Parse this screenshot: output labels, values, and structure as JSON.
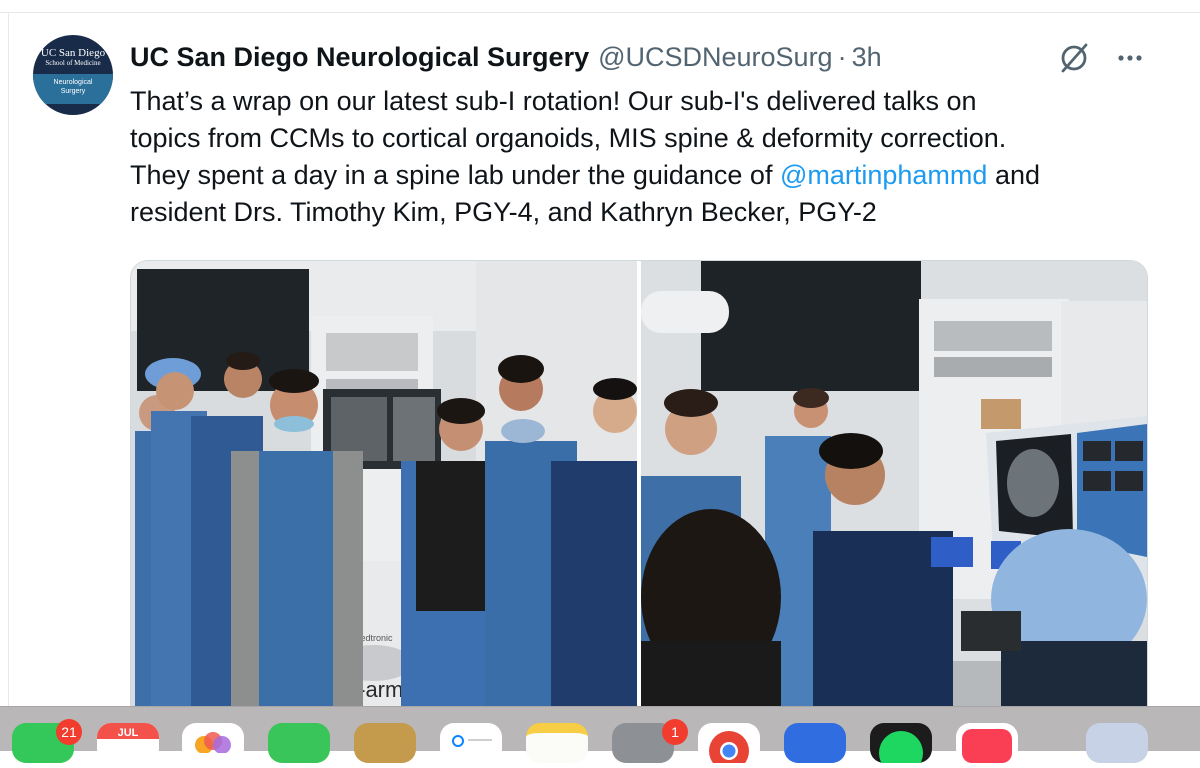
{
  "tweet": {
    "author_name": "UC San Diego Neurological Surgery",
    "author_handle": "@UCSDNeuroSurg",
    "separator": "·",
    "time": "3h",
    "avatar": {
      "line1": "UC San Diego",
      "line2": "School of Medicine",
      "line3": "Neurological",
      "line4": "Surgery"
    },
    "text": {
      "line1": "That’s a wrap on our latest sub-I rotation! Our sub-I's delivered talks on",
      "line2": "topics from CCMs to cortical organoids, MIS spine & deformity correction.",
      "line3_a": "They spent a day in a spine lab under the guidance of ",
      "mention": "@martinphammd",
      "line3_b": " and",
      "line4": "resident Drs. Timothy Kim, PGY-4, and Kathryn Becker, PGY-2"
    },
    "photo_text": {
      "device_label": "O-arm",
      "device_brand": "Medtronic"
    },
    "icons": [
      "grok-icon",
      "more-icon"
    ]
  },
  "dock": {
    "messages_badge": "21",
    "calendar_month": "JUL",
    "settings_badge": "1",
    "apps": [
      "messages-icon",
      "calendar-icon",
      "photos-icon",
      "facetime-icon",
      "finder-icon",
      "reminders-icon",
      "notes-icon",
      "system-settings-icon",
      "chrome-icon",
      "blue-app-icon",
      "spotify-icon",
      "news-icon",
      "preview-icon"
    ]
  },
  "colors": {
    "link": "#1d9bf0",
    "secondary_text": "#536471",
    "avatar_navy": "#182b49",
    "avatar_blue": "#2b6f9b",
    "badge_red": "#f23c2e"
  }
}
